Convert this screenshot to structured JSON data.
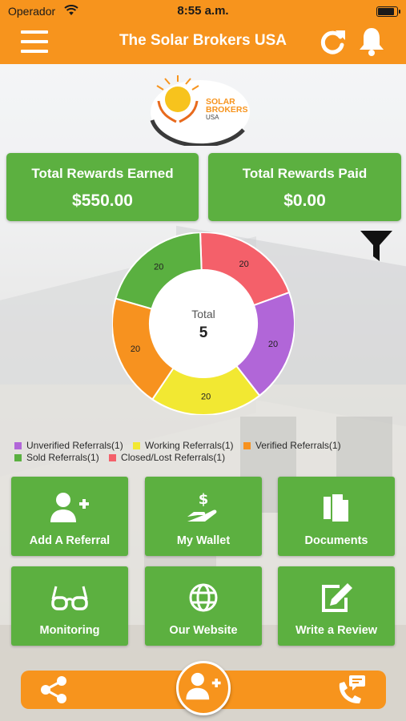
{
  "status_bar": {
    "carrier": "Operador",
    "time": "8:55 a.m."
  },
  "nav": {
    "title": "The Solar Brokers USA"
  },
  "logo": {
    "line1": "SOLAR",
    "line2": "BROKERS",
    "line3": "USA"
  },
  "rewards": {
    "earned_label": "Total Rewards Earned",
    "earned_value": "$550.00",
    "paid_label": "Total Rewards Paid",
    "paid_value": "$0.00"
  },
  "chart_data": {
    "type": "pie",
    "center_label": "Total",
    "center_value": "5",
    "slices": [
      {
        "name": "Closed/Lost Referrals",
        "value": 20,
        "color": "#f4606a"
      },
      {
        "name": "Unverified Referrals",
        "value": 20,
        "color": "#b166d8"
      },
      {
        "name": "Working Referrals",
        "value": 20,
        "color": "#f2e832"
      },
      {
        "name": "Verified Referrals",
        "value": 20,
        "color": "#f7921f"
      },
      {
        "name": "Sold Referrals",
        "value": 20,
        "color": "#5ab040"
      }
    ]
  },
  "legend": [
    [
      {
        "label": "Unverified Referrals(1)",
        "color": "#b166d8"
      },
      {
        "label": "Working Referrals(1)",
        "color": "#f2e832"
      },
      {
        "label": "Verified Referrals(1)",
        "color": "#f7921f"
      }
    ],
    [
      {
        "label": "Sold Referrals(1)",
        "color": "#5ab040"
      },
      {
        "label": "Closed/Lost Referrals(1)",
        "color": "#f4606a"
      }
    ]
  ],
  "tiles": [
    {
      "label": "Add A Referral",
      "icon": "add-user-icon"
    },
    {
      "label": "My Wallet",
      "icon": "wallet-hand-dollar-icon"
    },
    {
      "label": "Documents",
      "icon": "documents-icon"
    },
    {
      "label": "Monitoring",
      "icon": "glasses-icon"
    },
    {
      "label": "Our Website",
      "icon": "globe-icon"
    },
    {
      "label": "Write a Review",
      "icon": "edit-icon"
    }
  ],
  "colors": {
    "orange": "#f7941d",
    "green": "#5cb040"
  }
}
